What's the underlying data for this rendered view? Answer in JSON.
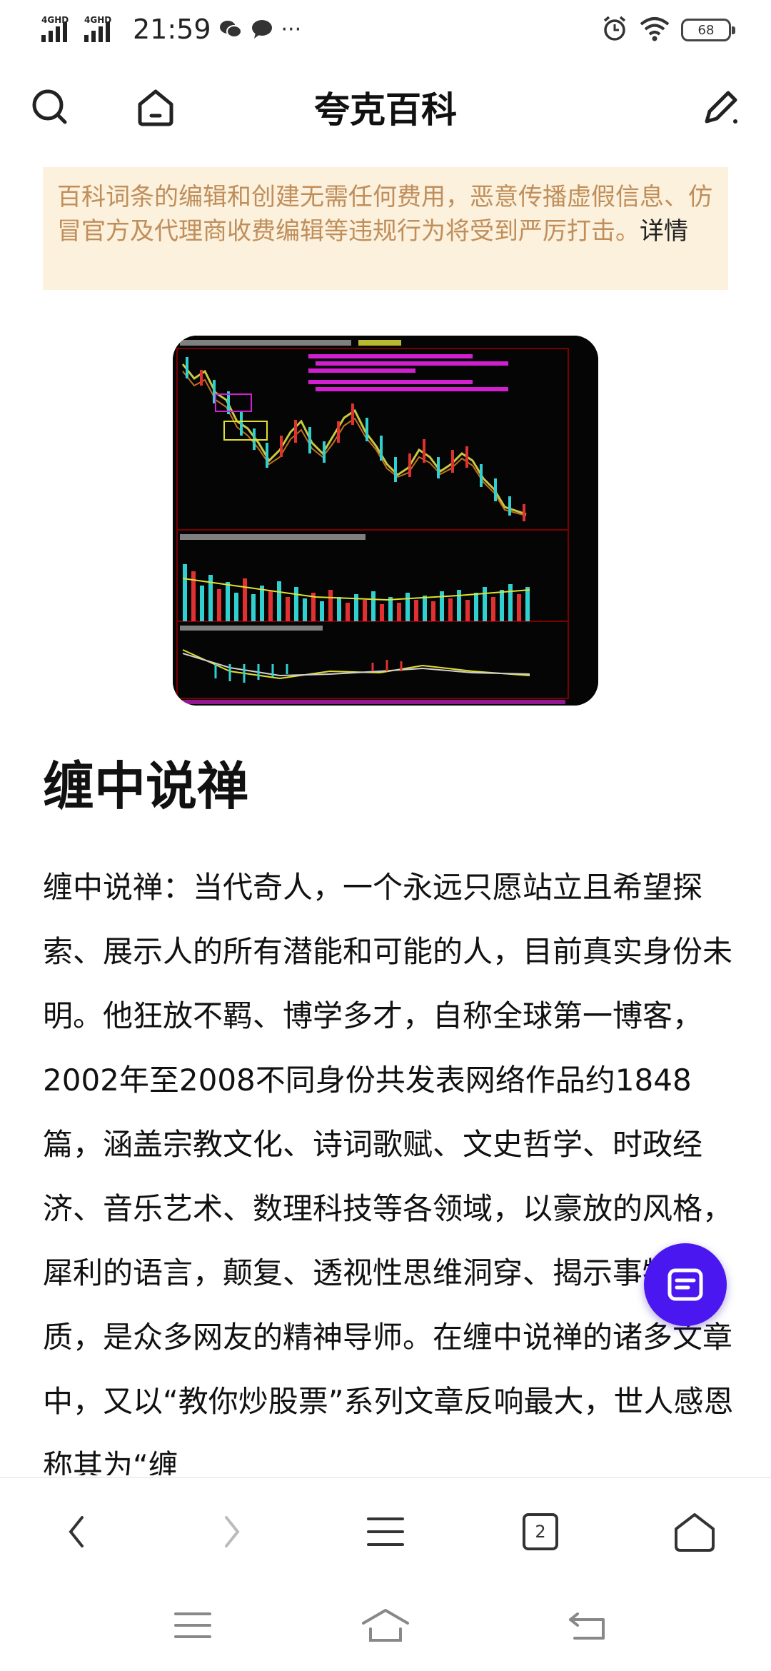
{
  "status_bar": {
    "network1": "4GHD",
    "network2": "4GHD",
    "time": "21:59",
    "more": "···",
    "battery": "68"
  },
  "header": {
    "title": "夸克百科"
  },
  "notice": {
    "text": "百科词条的编辑和创建无需任何费用，恶意传播虚假信息、仿冒官方及代理商收费编辑等违规行为将受到严厉打击。",
    "detail_link": "详情"
  },
  "article": {
    "title": "缠中说禅",
    "body": "缠中说禅：当代奇人，一个永远只愿站立且希望探索、展示人的所有潜能和可能的人，目前真实身份未明。他狂放不羁、博学多才，自称全球第一博客，2002年至2008不同身份共发表网络作品约1848篇，涵盖宗教文化、诗词歌赋、文史哲学、时政经济、音乐艺术、数理科技等各领域，以豪放的风格，犀利的语言，颠复、透视性思维洞穿、揭示事物本质，是众多网友的精神导师。在缠中说禅的诸多文章中，又以“教你炒股票”系列文章反响最大，世人感恩称其为“缠"
  },
  "bottom_nav": {
    "tab_count": "2"
  },
  "icons": {
    "search": "search-icon",
    "home": "home-icon",
    "edit": "edit-icon",
    "back": "back-icon",
    "forward": "forward-icon",
    "menu": "menu-icon",
    "tabs": "tabs-icon",
    "home_nav": "home-nav-icon",
    "fab": "notes-icon"
  },
  "colors": {
    "accent": "#4a17f0",
    "notice_bg": "#fbf1dc",
    "notice_text": "#c08e5b"
  }
}
